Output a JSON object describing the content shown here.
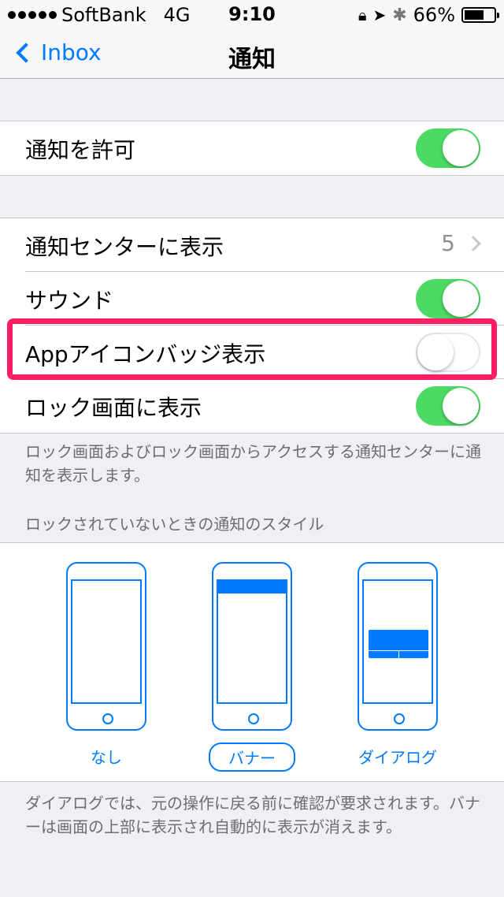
{
  "status_bar": {
    "carrier": "SoftBank",
    "network": "4G",
    "time": "9:10",
    "battery": "66%",
    "battery_level": 0.66
  },
  "nav": {
    "back_label": "Inbox",
    "title": "通知"
  },
  "allow": {
    "label": "通知を許可",
    "on": true
  },
  "settings": {
    "notification_center_label": "通知センターに表示",
    "notification_center_value": "5",
    "sound_label": "サウンド",
    "badge_label": "Appアイコンバッジ表示",
    "lock_screen_label": "ロック画面に表示"
  },
  "footer_note": "ロック画面およびロック画面からアクセスする通知センターに通知を表示します。",
  "style_header": "ロックされていないときの通知のスタイル",
  "styles": [
    {
      "label": "なし"
    },
    {
      "label": "バナー"
    },
    {
      "label": "ダイアログ"
    }
  ],
  "bottom_note": "ダイアログでは、元の操作に戻る前に確認が要求されます。バナーは画面の上部に表示され自動的に表示が消えます。",
  "colors": {
    "accent": "#007aff",
    "toggle_on": "#4cd964",
    "highlight": "#ff1e64"
  }
}
